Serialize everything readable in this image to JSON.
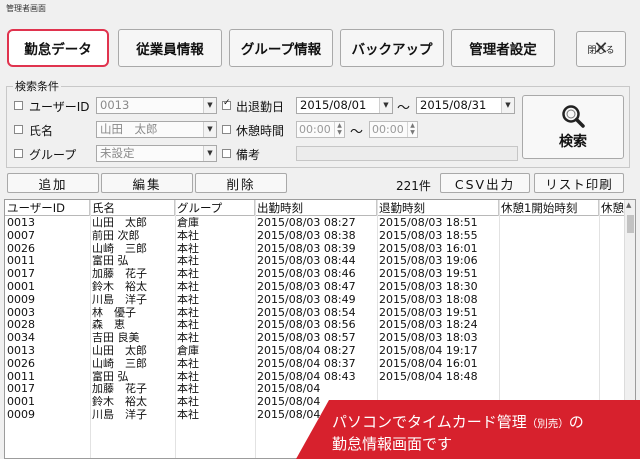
{
  "window": {
    "title": "管理者画面"
  },
  "toolbar": {
    "attendance": "勤怠データ",
    "employees": "従業員情報",
    "groups": "グループ情報",
    "backup": "バックアップ",
    "admin_settings": "管理者設定",
    "close": "閉じる"
  },
  "search": {
    "legend": "検索条件",
    "user_id_label": "ユーザーID",
    "user_id_value": "0013",
    "name_label": "氏名",
    "name_value": "山田　太郎",
    "group_label": "グループ",
    "group_value": "未設定",
    "date_label": "出退勤日",
    "date_from": "2015/08/01",
    "date_sep": "～",
    "date_to": "2015/08/31",
    "break_label": "休憩時間",
    "break_from": "00:00",
    "break_sep": "～",
    "break_to": "00:00",
    "memo_label": "備考",
    "button": "検索"
  },
  "actions": {
    "add": "追加",
    "edit": "編集",
    "delete": "削除",
    "count": "221件",
    "csv": "CSV出力",
    "print": "リスト印刷"
  },
  "table": {
    "headers": [
      "ユーザーID",
      "氏名",
      "グループ",
      "出勤時刻",
      "退勤時刻",
      "休憩1開始時刻",
      "休憩"
    ],
    "rows": [
      [
        "0013",
        "山田　太郎",
        "倉庫",
        "2015/08/03 08:27",
        "2015/08/03 18:51"
      ],
      [
        "0007",
        "前田 次郎",
        "本社",
        "2015/08/03 08:38",
        "2015/08/03 18:55"
      ],
      [
        "0026",
        "山崎　三郎",
        "本社",
        "2015/08/03 08:39",
        "2015/08/03 16:01"
      ],
      [
        "0011",
        "富田 弘",
        "本社",
        "2015/08/03 08:44",
        "2015/08/03 19:06"
      ],
      [
        "0017",
        "加藤　花子",
        "本社",
        "2015/08/03 08:46",
        "2015/08/03 19:51"
      ],
      [
        "0001",
        "鈴木　裕太",
        "本社",
        "2015/08/03 08:47",
        "2015/08/03 18:30"
      ],
      [
        "0009",
        "川島　洋子",
        "本社",
        "2015/08/03 08:49",
        "2015/08/03 18:08"
      ],
      [
        "0003",
        "林　優子",
        "本社",
        "2015/08/03 08:54",
        "2015/08/03 19:51"
      ],
      [
        "0028",
        "森　恵",
        "本社",
        "2015/08/03 08:56",
        "2015/08/03 18:24"
      ],
      [
        "0034",
        "吉田 良美",
        "本社",
        "2015/08/03 08:57",
        "2015/08/03 18:03"
      ],
      [
        "0013",
        "山田　太郎",
        "倉庫",
        "2015/08/04 08:27",
        "2015/08/04 19:17"
      ],
      [
        "0026",
        "山崎　三郎",
        "本社",
        "2015/08/04 08:37",
        "2015/08/04 16:01"
      ],
      [
        "0011",
        "富田 弘",
        "本社",
        "2015/08/04 08:43",
        "2015/08/04 18:48"
      ],
      [
        "0017",
        "加藤　花子",
        "本社",
        "2015/08/04",
        ""
      ],
      [
        "0001",
        "鈴木　裕太",
        "本社",
        "2015/08/04",
        ""
      ],
      [
        "0009",
        "川島　洋子",
        "本社",
        "2015/08/04",
        ""
      ]
    ]
  },
  "banner": {
    "line1_main": "パソコンでタイムカード管理",
    "line1_small": "（別売）",
    "line1_tail": "の",
    "line2": "勤怠情報画面です"
  },
  "colors": {
    "active_border": "#e0334e",
    "banner": "#d7212d"
  },
  "icons": {
    "search": "magnifier-icon",
    "close": "x-icon"
  }
}
